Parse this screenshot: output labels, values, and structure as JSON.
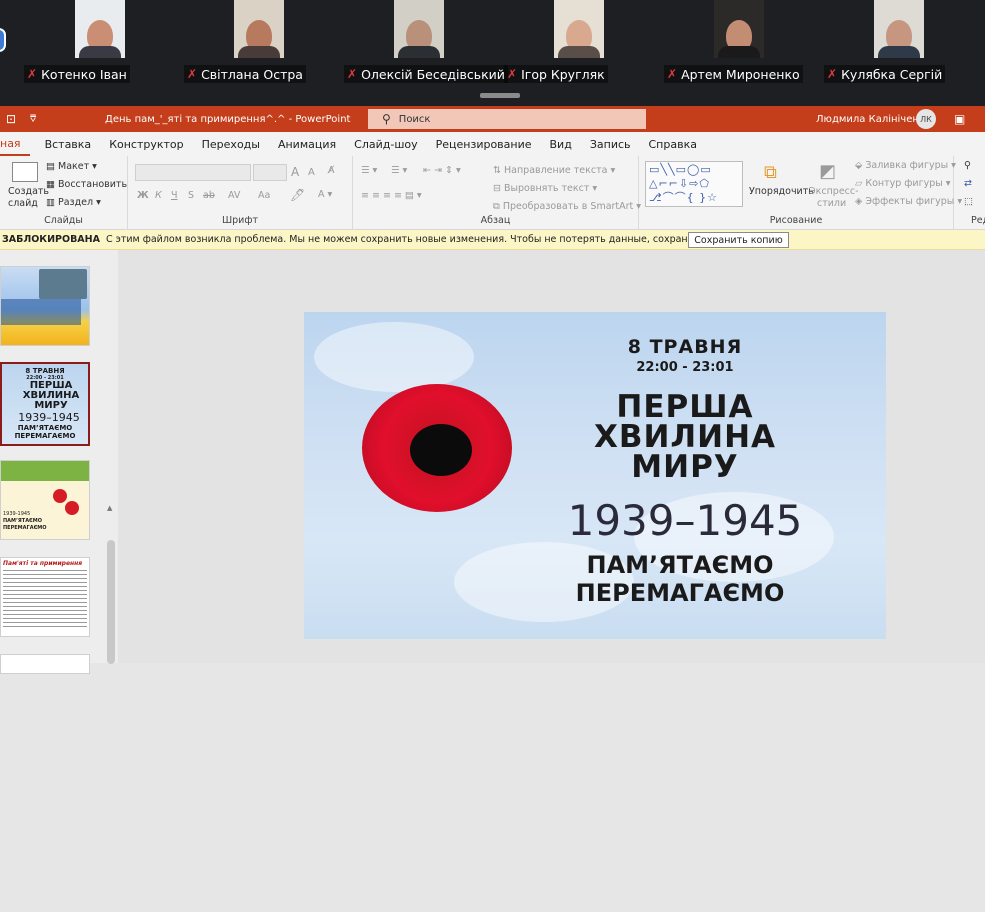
{
  "participants": [
    {
      "name": "Котенко Іван"
    },
    {
      "name": "Світлана Остра"
    },
    {
      "name": "Олексій  Бесeдівський"
    },
    {
      "name": "Ігор Кругляк"
    },
    {
      "name": "Артем Мироненко"
    },
    {
      "name": "Кулябка Сергій"
    }
  ],
  "titlebar": {
    "doc_title": "День пам_'_яті та примирення^.^  -  PowerPoint",
    "search_placeholder": "Поиск",
    "user_name": "Людмила Калініченко",
    "user_initials": "ЛК"
  },
  "tabs": [
    "Главная",
    "Вставка",
    "Конструктор",
    "Переходы",
    "Анимация",
    "Слайд-шоу",
    "Рецензирование",
    "Вид",
    "Запись",
    "Справка"
  ],
  "tabs_visible": [
    "ная",
    "Вставка",
    "Конструктор",
    "Переходы",
    "Анимация",
    "Слайд-шоу",
    "Рецензирование",
    "Вид",
    "Запись",
    "Справка"
  ],
  "ribbon": {
    "slides": {
      "create": "Создать",
      "create2": "слайд",
      "layout": "Макет",
      "reset": "Восстановить",
      "section": "Раздел",
      "label": "Слайды"
    },
    "font": {
      "label": "Шрифт",
      "bold": "Ж",
      "italic": "К",
      "underline": "Ч",
      "strike": "S",
      "ab": "ab",
      "av": "AV",
      "aa": "Aa",
      "A_up": "A",
      "A_down": "A"
    },
    "paragraph": {
      "label": "Абзац",
      "dir": "Направление текста",
      "align": "Выровнять текст",
      "smart": "Преобразовать в SmartArt"
    },
    "drawing": {
      "label": "Рисование",
      "arrange": "Упорядочить",
      "styles": "Экспресс-",
      "styles2": "стили",
      "fill": "Заливка фигуры",
      "outline": "Контур фигуры",
      "effects": "Эффекты фигуры"
    },
    "edit_label": "Ред"
  },
  "message": {
    "title": "ЗАБЛОКИРОВАНА",
    "text": "С этим файлом возникла проблема. Мы не можем сохранить новые изменения. Чтобы не потерять данные, сохраните его как копию.",
    "button": "Сохранить копию"
  },
  "slide": {
    "date": "8 ТРАВНЯ",
    "time": "22:00 - 23:01",
    "line1": "ПЕРША",
    "line2": "ХВИЛИНА",
    "line3": "МИРУ",
    "years": "1939–1945",
    "remember": "ПАМ’ЯТАЄМО",
    "win": "ПЕРЕМАГАЄМО"
  },
  "thumbs": {
    "t2_date": "8 ТРАВНЯ",
    "t2_time": "22:00 - 23:01",
    "t2_l1": "ПЕРША",
    "t2_l2": "ХВИЛИНА",
    "t2_l3": "МИРУ",
    "t2_years": "1939–1945",
    "t2_remember": "ПАМ’ЯТАЄМО",
    "t2_win": "ПЕРЕМАГАЄМО",
    "t3_years": "1939-1945",
    "t3_l1": "ПАМ’ЯТАЄМО",
    "t3_l2": "ПЕРЕМАГАЄМО",
    "t4_title": "Пам'яті та примирення"
  },
  "colors": {
    "accent": "#c43e1c",
    "search": "#f3c7b7",
    "warning": "#fcf6c7",
    "poppy": "#e10f2c"
  }
}
